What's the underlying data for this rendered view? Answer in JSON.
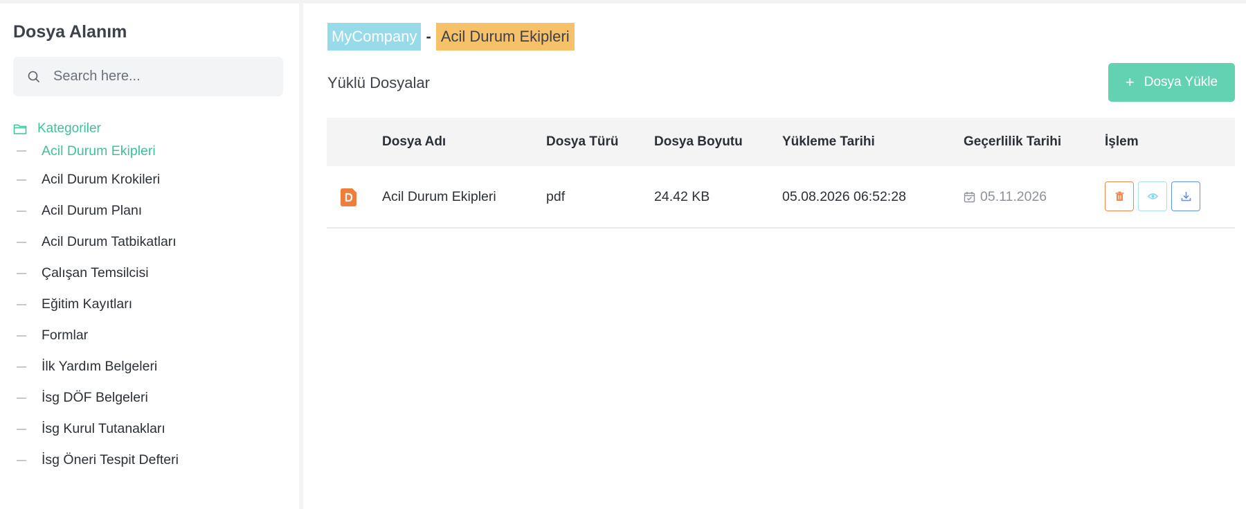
{
  "sidebar": {
    "title": "Dosya Alanım",
    "search_placeholder": "Search here...",
    "category_label": "Kategoriler",
    "items": [
      {
        "label": "Acil Durum Ekipleri",
        "active": true
      },
      {
        "label": "Acil Durum Krokileri"
      },
      {
        "label": "Acil Durum Planı"
      },
      {
        "label": "Acil Durum Tatbikatları"
      },
      {
        "label": "Çalışan Temsilcisi"
      },
      {
        "label": "Eğitim Kayıtları"
      },
      {
        "label": "Formlar"
      },
      {
        "label": "İlk Yardım Belgeleri"
      },
      {
        "label": "İsg DÖF Belgeleri"
      },
      {
        "label": "İsg Kurul Tutanakları"
      },
      {
        "label": "İsg Öneri Tespit Defteri"
      }
    ]
  },
  "breadcrumb": {
    "company": "MyCompany",
    "separator": "-",
    "section": "Acil Durum Ekipleri"
  },
  "main": {
    "section_title": "Yüklü Dosyalar",
    "upload_button": "Dosya Yükle",
    "columns": [
      "Dosya Adı",
      "Dosya Türü",
      "Dosya Boyutu",
      "Yükleme Tarihi",
      "Geçerlilik Tarihi",
      "İşlem"
    ],
    "rows": [
      {
        "icon": "pdf-file-icon",
        "name": "Acil Durum Ekipleri",
        "type": "pdf",
        "size": "24.42 KB",
        "uploaded": "05.08.2026 06:52:28",
        "valid_until": "05.11.2026"
      }
    ]
  },
  "colors": {
    "accent": "#3fbf9c",
    "upload_button": "#63d2b2",
    "company_badge": "#96dbe7",
    "section_badge": "#f7c16a",
    "pdf_icon": "#ef7d3c",
    "delete": "#f0884e",
    "view": "#a9e2ec",
    "download": "#5f93ec"
  }
}
